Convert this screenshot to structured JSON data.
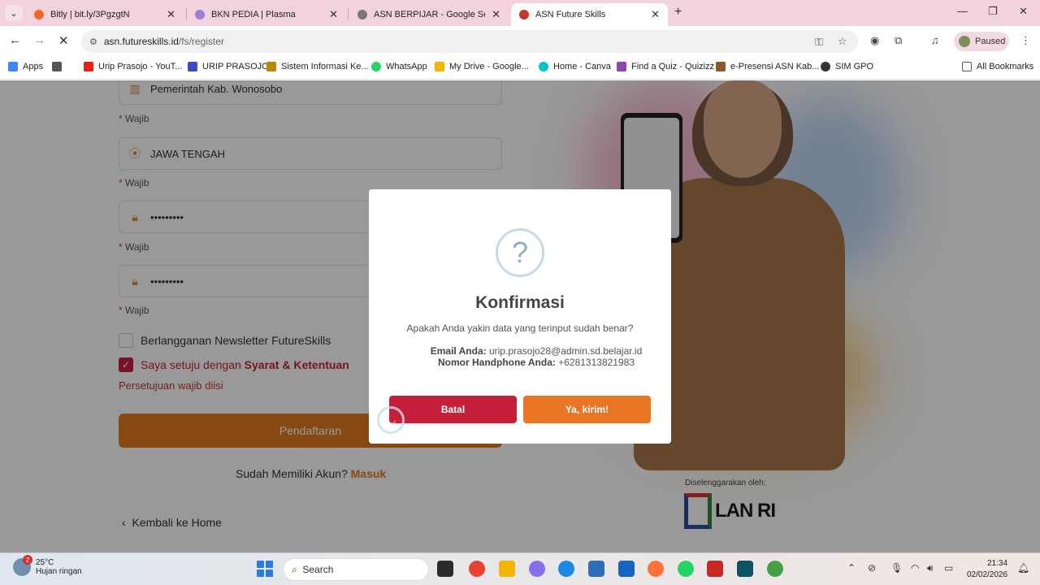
{
  "browser": {
    "tabs": [
      {
        "title": "Bitly | bit.ly/3PgzgtN",
        "color": "#f26a21"
      },
      {
        "title": "BKN PEDIA | Plasma",
        "color": "#9b7fd1"
      },
      {
        "title": "ASN BERPIJAR - Google Search",
        "color": "#777777"
      },
      {
        "title": "ASN Future Skills",
        "color": "#c0392b"
      }
    ],
    "url_host": "asn.futureskills.id",
    "url_path": "/fs/register",
    "profile_label": "Paused",
    "bookmarks": [
      {
        "label": "Apps",
        "color": "#4285f4"
      },
      {
        "label": "Urip Prasojo - YouT...",
        "color": "#e62117"
      },
      {
        "label": "URIP PRASOJO",
        "color": "#3b4cc0"
      },
      {
        "label": "Sistem Informasi Ke...",
        "color": "#b8860b"
      },
      {
        "label": "WhatsApp",
        "color": "#25d366"
      },
      {
        "label": "My Drive - Google...",
        "color": "#f4b400"
      },
      {
        "label": "Home - Canva",
        "color": "#00c4cc"
      },
      {
        "label": "Find a Quiz - Quizizz",
        "color": "#8e44ad"
      },
      {
        "label": "e-Presensi ASN Kab...",
        "color": "#8b5a2b"
      },
      {
        "label": "SIM GPO",
        "color": "#333333"
      }
    ],
    "all_bookmarks": "All Bookmarks"
  },
  "form": {
    "instansi_value": "Pemerintah Kab. Wonosobo",
    "provinsi_value": "JAWA TENGAH",
    "password_value": "•••••••••",
    "password_confirm_value": "•••••••••",
    "required_label": "* Wajib",
    "newsletter_label": "Berlangganan Newsletter FutureSkills",
    "agree_prefix": "Saya setuju dengan ",
    "agree_link": "Syarat & Ketentuan",
    "agree_error": "Persetujuan wajib diisi",
    "register_button": "Pendaftaran",
    "login_prompt": "Sudah Memiliki Akun?",
    "login_link": "Masuk",
    "back_home": "Kembali ke Home"
  },
  "organizer": {
    "label": "Diselenggarakan oleh:",
    "logo_text": "LAN RI"
  },
  "modal": {
    "icon": "?",
    "title": "Konfirmasi",
    "message": "Apakah Anda yakin data yang terinput sudah benar?",
    "email_label": "Email Anda:",
    "email_value": "urip.prasojo28@admin.sd.belajar.id",
    "phone_label": "Nomor Handphone Anda:",
    "phone_value": "+6281313821983",
    "cancel_button": "Batal",
    "confirm_button": "Ya, kirim!"
  },
  "taskbar": {
    "weather_temp": "25°C",
    "weather_desc": "Hujan ringan",
    "weather_badge": "2",
    "search_label": "Search",
    "time": "21:34",
    "date": "02/02/2026"
  }
}
